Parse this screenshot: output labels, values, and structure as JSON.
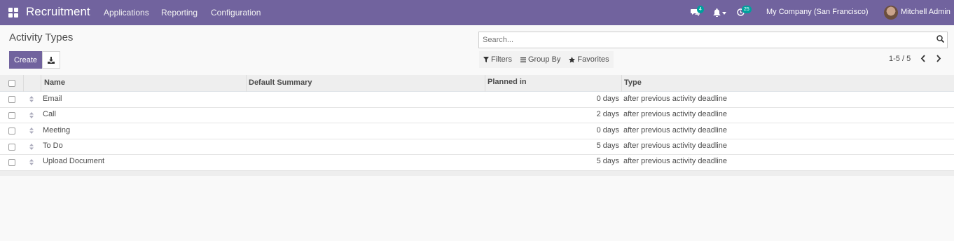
{
  "navbar": {
    "app_name": "Recruitment",
    "menu": [
      "Applications",
      "Reporting",
      "Configuration"
    ],
    "messages_count": "4",
    "activities_count": "25",
    "company": "My Company (San Francisco)",
    "user": "Mitchell Admin",
    "bg_color": "#71639e"
  },
  "control_panel": {
    "title": "Activity Types",
    "create_label": "Create",
    "search_placeholder": "Search...",
    "filters_label": "Filters",
    "group_by_label": "Group By",
    "favorites_label": "Favorites",
    "pager": "1-5 / 5"
  },
  "table": {
    "columns": [
      "Name",
      "Default Summary",
      "Planned in",
      "Type"
    ],
    "rows": [
      {
        "name": "Email",
        "summary": "",
        "planned": "0 days",
        "type": "after previous activity deadline"
      },
      {
        "name": "Call",
        "summary": "",
        "planned": "2 days",
        "type": "after previous activity deadline"
      },
      {
        "name": "Meeting",
        "summary": "",
        "planned": "0 days",
        "type": "after previous activity deadline"
      },
      {
        "name": "To Do",
        "summary": "",
        "planned": "5 days",
        "type": "after previous activity deadline"
      },
      {
        "name": "Upload Document",
        "summary": "",
        "planned": "5 days",
        "type": "after previous activity deadline"
      }
    ]
  }
}
